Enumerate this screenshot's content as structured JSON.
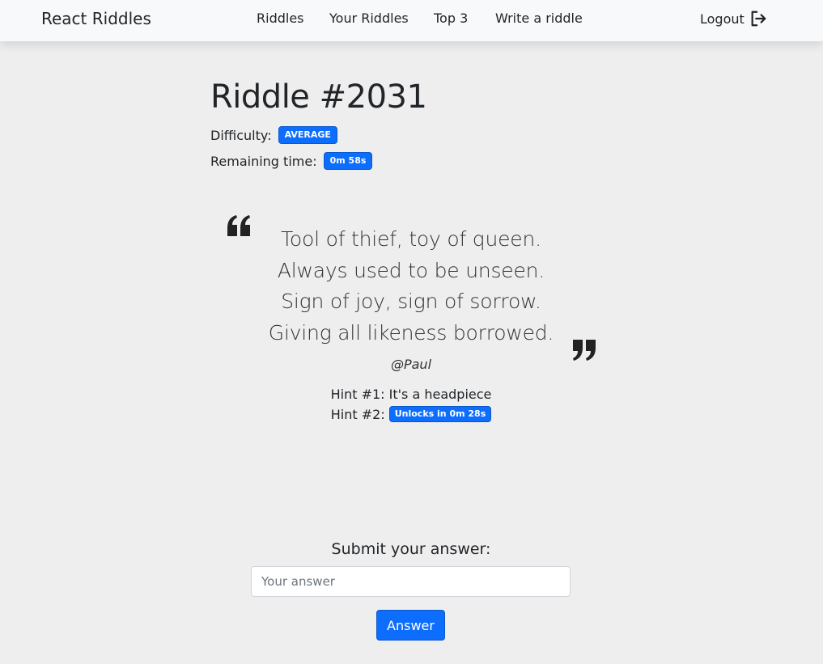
{
  "navbar": {
    "brand": "React Riddles",
    "links": [
      "Riddles",
      "Your Riddles",
      "Top 3",
      "Write a riddle"
    ],
    "logout_label": "Logout",
    "logout_icon": "logout-icon"
  },
  "riddle": {
    "title": "Riddle #2031",
    "difficulty_label": "Difficulty:",
    "difficulty_value": "AVERAGE",
    "remaining_label": "Remaining time:",
    "remaining_value": "0m 58s",
    "lines": [
      "Tool of thief, toy of queen.",
      "Always used to be unseen.",
      "Sign of joy, sign of sorrow.",
      "Giving all likeness borrowed."
    ],
    "author": "@Paul",
    "hint1_label": "Hint #1:",
    "hint1_text": "It's a headpiece",
    "hint2_label": "Hint #2:",
    "hint2_badge": "Unlocks in 0m 28s"
  },
  "answer": {
    "title": "Submit your answer:",
    "placeholder": "Your answer",
    "value": "",
    "button_label": "Answer"
  },
  "colors": {
    "accent": "#0d6efd",
    "background": "#eeeeee",
    "navbar": "#f8f9fa"
  }
}
